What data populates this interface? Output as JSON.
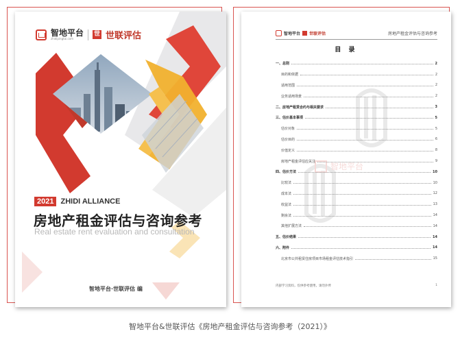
{
  "cover": {
    "logo_zhidi": "智地平台",
    "logo_zhidi_sub": "zhidipingtai.com",
    "logo_shilian": "世联评估",
    "year": "2021",
    "alliance": "ZHIDI ALLIANCE",
    "title": "房地产租金评估与咨询参考",
    "subtitle": "Real estate rent evaluation and consultation",
    "editor": "智地平台·世联评估  编"
  },
  "toc": {
    "header_logo_zhidi": "智地平台",
    "header_logo_shilian": "世联评估",
    "header_title": "房地产租金评估与咨询参考",
    "title": "目  录",
    "items": [
      {
        "label": "一、总则",
        "page": "2",
        "level": 1
      },
      {
        "label": "目的和依据",
        "page": "2",
        "level": 2
      },
      {
        "label": "适用范围",
        "page": "2",
        "level": 2
      },
      {
        "label": "业务适用场景",
        "page": "2",
        "level": 2
      },
      {
        "label": "二、房地产租赁合约与相关要求",
        "page": "3",
        "level": 1
      },
      {
        "label": "三、估价基本事项",
        "page": "5",
        "level": 1
      },
      {
        "label": "估价对象",
        "page": "5",
        "level": 2
      },
      {
        "label": "估价目的",
        "page": "6",
        "level": 2
      },
      {
        "label": "价值定义",
        "page": "8",
        "level": 2
      },
      {
        "label": "房地产租金评估应关注",
        "page": "9",
        "level": 2
      },
      {
        "label": "四、估价方法",
        "page": "10",
        "level": 1
      },
      {
        "label": "比较法",
        "page": "10",
        "level": 2
      },
      {
        "label": "成本法",
        "page": "12",
        "level": 2
      },
      {
        "label": "收益法",
        "page": "13",
        "level": 2
      },
      {
        "label": "剩余法",
        "page": "14",
        "level": 2
      },
      {
        "label": "其他扩展方法",
        "page": "14",
        "level": 2
      },
      {
        "label": "五、估价结果",
        "page": "14",
        "level": 1
      },
      {
        "label": "六、附件",
        "page": "14",
        "level": 1
      },
      {
        "label": "北京市公共租赁住房项目市场租金评估技术指引",
        "page": "15",
        "level": 2
      }
    ],
    "footer_note": "内部学习资料，仅供参考使用，请勿外传",
    "footer_page": "1"
  },
  "caption": "智地平台&世联评估《房地产租金评估与咨询参考（2021）》",
  "colors": {
    "accent_red": "#d23a2f",
    "accent_yellow": "#f1b12e",
    "frame_red": "#d9534f"
  }
}
